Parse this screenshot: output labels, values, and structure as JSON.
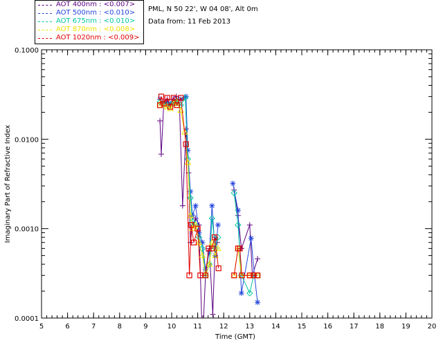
{
  "header": {
    "site_line": "PML, N 50 22', W 04 08', Alt 0m",
    "date_line": "Data from: 11 Feb 2013"
  },
  "legend": [
    {
      "label": "AOT  400nm : <0.007>",
      "color": "#5a0080"
    },
    {
      "label": "AOT  500nm : <0.010>",
      "color": "#2244dd"
    },
    {
      "label": "AOT  675nm : <0.010>",
      "color": "#00c8a0"
    },
    {
      "label": "AOT  870nm : <0.008>",
      "color": "#f0e000"
    },
    {
      "label": "AOT 1020nm : <0.009>",
      "color": "#e00000"
    }
  ],
  "chart_data": {
    "type": "line",
    "title": "",
    "xlabel": "Time (GMT)",
    "ylabel": "Imaginary Part of Refractive Index",
    "xlim": [
      5,
      20
    ],
    "ylim": [
      0.0001,
      0.1
    ],
    "y_scale": "log",
    "x_ticks": [
      "5",
      "6",
      "7",
      "8",
      "9",
      "10",
      "11",
      "12",
      "13",
      "14",
      "15",
      "16",
      "17",
      "18",
      "19",
      "20"
    ],
    "y_ticks": [
      {
        "value": 0.0001,
        "label": "0.0001"
      },
      {
        "value": 0.001,
        "label": "0.0010"
      },
      {
        "value": 0.01,
        "label": "0.0100"
      },
      {
        "value": 0.1,
        "label": "0.1000"
      }
    ],
    "grid": false,
    "series": [
      {
        "name": "AOT  400nm : <0.007>",
        "color": "#5a0080",
        "marker": "plus",
        "points": [
          [
            9.55,
            0.016
          ],
          [
            9.6,
            0.0068
          ],
          [
            9.7,
            0.026
          ],
          [
            9.83,
            0.028
          ],
          [
            9.95,
            0.024
          ],
          [
            10.05,
            0.028
          ],
          [
            10.18,
            0.03
          ],
          [
            10.3,
            0.024
          ],
          [
            10.42,
            0.0018
          ],
          [
            10.55,
            0.013
          ],
          [
            10.65,
            0.0042
          ],
          [
            10.72,
            0.0007
          ],
          [
            10.8,
            0.0011
          ],
          [
            10.92,
            0.0013
          ],
          [
            11.05,
            0.0011
          ],
          [
            11.18,
            4e-05
          ],
          [
            11.3,
            0.0003
          ],
          [
            11.45,
            0.0006
          ],
          [
            11.58,
            0.00011
          ],
          [
            11.68,
            0.0008
          ],
          [
            11.75,
            0.0007
          ],
          [
            12.4,
            0.0027
          ],
          [
            12.55,
            0.0014
          ],
          [
            12.68,
            0.0006
          ],
          [
            13.0,
            0.0011
          ],
          [
            13.1,
            0.0003
          ],
          [
            13.3,
            0.00046
          ]
        ]
      },
      {
        "name": "AOT  500nm : <0.010>",
        "color": "#2244dd",
        "marker": "asterisk",
        "points": [
          [
            9.55,
            0.028
          ],
          [
            9.7,
            0.025
          ],
          [
            9.83,
            0.026
          ],
          [
            9.95,
            0.025
          ],
          [
            10.08,
            0.025
          ],
          [
            10.2,
            0.026
          ],
          [
            10.35,
            0.028
          ],
          [
            10.55,
            0.03
          ],
          [
            10.62,
            0.0075
          ],
          [
            10.72,
            0.0026
          ],
          [
            10.8,
            0.0014
          ],
          [
            10.92,
            0.0018
          ],
          [
            11.05,
            0.0009
          ],
          [
            11.18,
            0.0007
          ],
          [
            11.3,
            0.00035
          ],
          [
            11.45,
            0.00055
          ],
          [
            11.55,
            0.0018
          ],
          [
            11.68,
            0.0005
          ],
          [
            11.78,
            0.0011
          ],
          [
            12.35,
            0.0032
          ],
          [
            12.55,
            0.0016
          ],
          [
            12.68,
            0.00019
          ],
          [
            13.05,
            0.00078
          ],
          [
            13.18,
            0.0003
          ],
          [
            13.3,
            0.00015
          ]
        ]
      },
      {
        "name": "AOT  675nm : <0.010>",
        "color": "#00c8a0",
        "marker": "diamond",
        "points": [
          [
            9.55,
            0.026
          ],
          [
            9.7,
            0.025
          ],
          [
            9.83,
            0.024
          ],
          [
            9.95,
            0.024
          ],
          [
            10.08,
            0.026
          ],
          [
            10.2,
            0.027
          ],
          [
            10.35,
            0.024
          ],
          [
            10.52,
            0.029
          ],
          [
            10.62,
            0.006
          ],
          [
            10.72,
            0.0022
          ],
          [
            10.8,
            0.0012
          ],
          [
            10.92,
            0.0011
          ],
          [
            11.05,
            0.0008
          ],
          [
            11.18,
            0.0006
          ],
          [
            11.3,
            0.0003
          ],
          [
            11.45,
            0.0004
          ],
          [
            11.55,
            0.0013
          ],
          [
            11.68,
            0.0006
          ],
          [
            11.78,
            0.0008
          ],
          [
            12.4,
            0.0025
          ],
          [
            12.55,
            0.0011
          ],
          [
            12.68,
            0.0003
          ],
          [
            13.0,
            0.00019
          ],
          [
            13.15,
            0.0003
          ],
          [
            13.3,
            0.0003
          ]
        ]
      },
      {
        "name": "AOT  870nm : <0.008>",
        "color": "#f0e000",
        "marker": "triangle",
        "points": [
          [
            9.55,
            0.025
          ],
          [
            9.7,
            0.024
          ],
          [
            9.83,
            0.023
          ],
          [
            9.95,
            0.022
          ],
          [
            10.08,
            0.025
          ],
          [
            10.2,
            0.026
          ],
          [
            10.35,
            0.021
          ],
          [
            10.5,
            0.012
          ],
          [
            10.62,
            0.0055
          ],
          [
            10.72,
            0.0014
          ],
          [
            10.8,
            0.001
          ],
          [
            10.92,
            0.0011
          ],
          [
            11.05,
            0.0007
          ],
          [
            11.18,
            0.0005
          ],
          [
            11.3,
            0.0003
          ],
          [
            11.45,
            0.0004
          ],
          [
            11.55,
            0.0007
          ],
          [
            11.68,
            0.0005
          ],
          [
            11.78,
            0.0006
          ],
          [
            12.4,
            0.0003
          ],
          [
            12.55,
            0.0006
          ],
          [
            12.68,
            0.0003
          ],
          [
            13.0,
            0.0003
          ],
          [
            13.15,
            0.0003
          ],
          [
            13.3,
            0.0003
          ]
        ]
      },
      {
        "name": "AOT 1020nm : <0.009>",
        "color": "#e00000",
        "marker": "square",
        "points": [
          [
            9.55,
            0.024
          ],
          [
            9.6,
            0.03
          ],
          [
            9.7,
            0.025
          ],
          [
            9.83,
            0.029
          ],
          [
            9.95,
            0.023
          ],
          [
            10.08,
            0.029
          ],
          [
            10.2,
            0.024
          ],
          [
            10.35,
            0.029
          ],
          [
            10.55,
            0.0088
          ],
          [
            10.68,
            0.0003
          ],
          [
            10.75,
            0.0011
          ],
          [
            10.85,
            0.0007
          ],
          [
            11.0,
            0.001
          ],
          [
            11.1,
            0.0003
          ],
          [
            11.3,
            0.0003
          ],
          [
            11.42,
            0.0006
          ],
          [
            11.55,
            0.0006
          ],
          [
            11.65,
            0.0008
          ],
          [
            11.8,
            0.00036
          ],
          [
            12.4,
            0.0003
          ],
          [
            12.55,
            0.0006
          ],
          [
            12.62,
            0.0006
          ],
          [
            12.7,
            0.0003
          ],
          [
            13.0,
            0.0003
          ],
          [
            13.15,
            0.0003
          ],
          [
            13.3,
            0.0003
          ]
        ]
      }
    ]
  }
}
